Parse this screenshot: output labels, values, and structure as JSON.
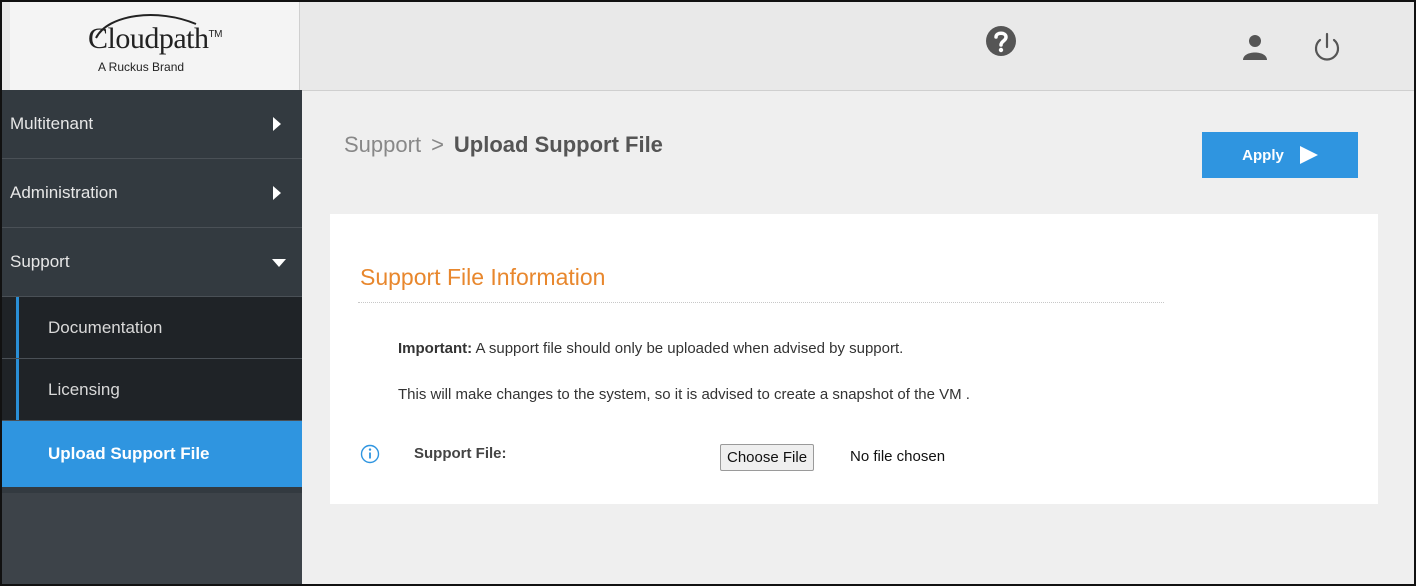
{
  "header": {
    "logo_main": "Cloudpath",
    "logo_tm": "TM",
    "logo_sub": "A Ruckus Brand",
    "icons": [
      "question-icon",
      "user-icon",
      "power-icon"
    ]
  },
  "sidebar": {
    "items": [
      {
        "label": "Multitenant",
        "icon": "chevron-right-icon"
      },
      {
        "label": "Administration",
        "icon": "chevron-right-icon"
      },
      {
        "label": "Support",
        "icon": "chevron-down-icon"
      }
    ],
    "sub_items": [
      {
        "label": "Documentation"
      },
      {
        "label": "Licensing"
      },
      {
        "label": "Upload Support File",
        "active": true
      }
    ]
  },
  "breadcrumb": {
    "parent": "Support",
    "separator": ">",
    "current": "Upload Support File"
  },
  "apply": {
    "label": "Apply"
  },
  "panel": {
    "title": "Support File Information",
    "important_label": "Important:",
    "important_text": " A support file should only be uploaded when advised by support.",
    "advice_text": "This will make changes to the system, so it is advised to create a snapshot of the VM .",
    "field_label": "Support File:",
    "choose_button": "Choose File",
    "no_file_text": "No file chosen"
  },
  "colors": {
    "accent_blue": "#2f95e0",
    "title_orange": "#e8872d",
    "sidebar_dark": "#333a40"
  }
}
